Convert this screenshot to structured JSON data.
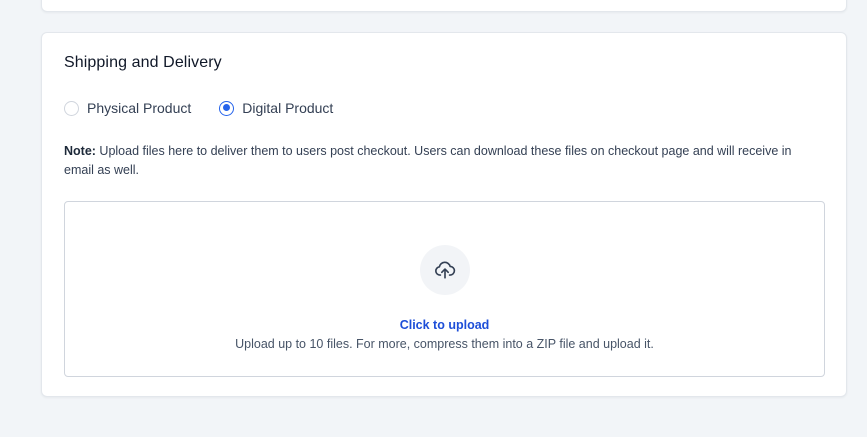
{
  "section": {
    "title": "Shipping and Delivery"
  },
  "delivery_type": {
    "options": [
      {
        "label": "Physical Product",
        "selected": false
      },
      {
        "label": "Digital Product",
        "selected": true
      }
    ]
  },
  "note": {
    "prefix": "Note:",
    "text": " Upload files here to deliver them to users post checkout. Users can download these files on checkout page and will receive in email as well."
  },
  "upload": {
    "icon": "upload-cloud-icon",
    "action_label": "Click to upload",
    "hint": "Upload up to 10 files. For more, compress them into a ZIP file and upload it."
  },
  "colors": {
    "accent": "#2563eb",
    "link": "#1d4ed8"
  }
}
